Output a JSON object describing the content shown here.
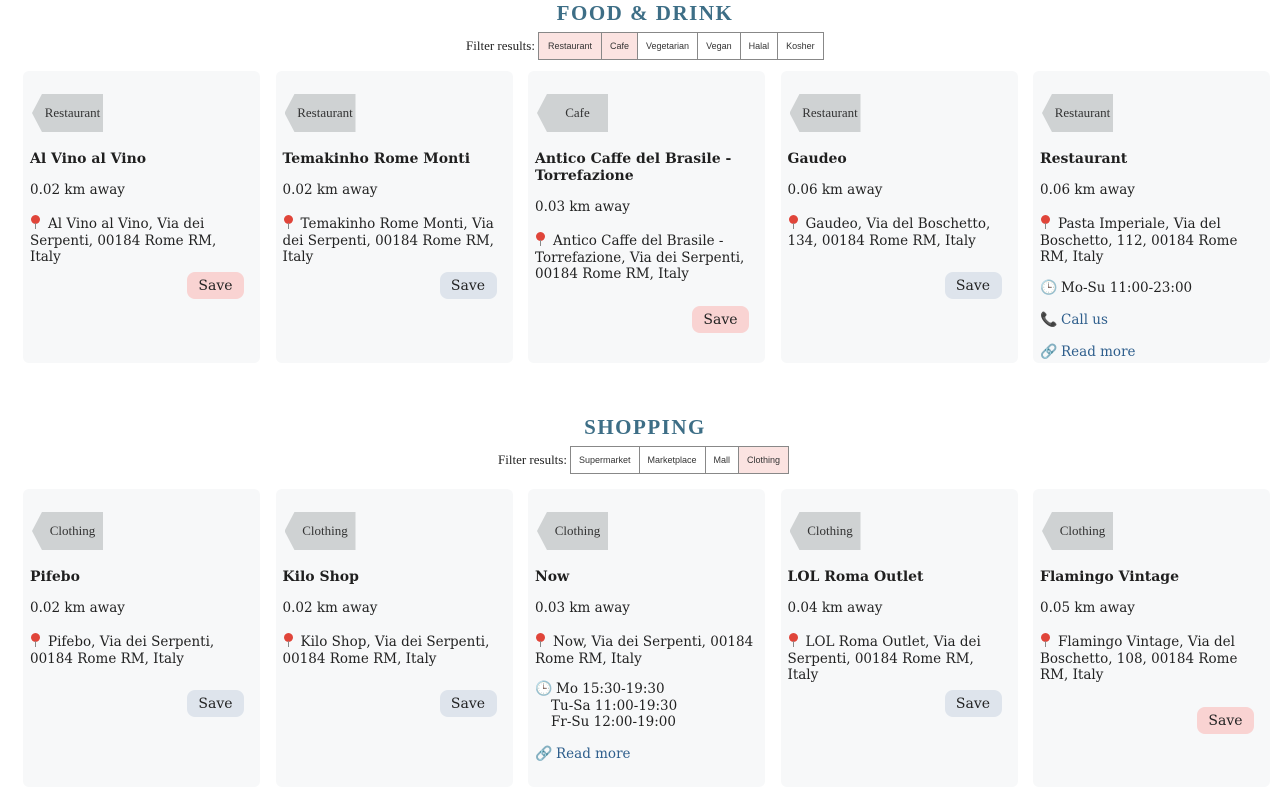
{
  "food": {
    "title": "FOOD & DRINK",
    "filter_label": "Filter results:",
    "filters": [
      "Restaurant",
      "Cafe",
      "Vegetarian",
      "Vegan",
      "Halal",
      "Kosher"
    ],
    "cards": [
      {
        "tag": "Restaurant",
        "name": "Al Vino al Vino",
        "distance": "0.02 km away",
        "address": "Al Vino al Vino, Via dei Serpenti, 00184 Rome RM, Italy",
        "save": "Save"
      },
      {
        "tag": "Restaurant",
        "name": "Temakinho Rome Monti",
        "distance": "0.02 km away",
        "address": "Temakinho Rome Monti, Via dei Serpenti, 00184 Rome RM, Italy",
        "save": "Save"
      },
      {
        "tag": "Cafe",
        "name": "Antico Caffe del Brasile - Torrefazione",
        "distance": "0.03 km away",
        "address": "Antico Caffe del Brasile - Torrefazione, Via dei Serpenti, 00184 Rome RM, Italy",
        "save": "Save"
      },
      {
        "tag": "Restaurant",
        "name": "Gaudeo",
        "distance": "0.06 km away",
        "address": "Gaudeo, Via del Boschetto, 134, 00184 Rome RM, Italy",
        "save": "Save"
      },
      {
        "tag": "Restaurant",
        "name": "Restaurant",
        "distance": "0.06 km away",
        "address": "Pasta Imperiale, Via del Boschetto, 112, 00184 Rome RM, Italy",
        "hours": "Mo-Su 11:00-23:00",
        "call": "Call us",
        "read_more": "Read more"
      }
    ]
  },
  "shopping": {
    "title": "SHOPPING",
    "filter_label": "Filter results:",
    "filters": [
      "Supermarket",
      "Marketplace",
      "Mall",
      "Clothing"
    ],
    "cards": [
      {
        "tag": "Clothing",
        "name": "Pifebo",
        "distance": "0.02 km away",
        "address": "Pifebo, Via dei Serpenti, 00184 Rome RM, Italy",
        "save": "Save"
      },
      {
        "tag": "Clothing",
        "name": "Kilo Shop",
        "distance": "0.02 km away",
        "address": "Kilo Shop, Via dei Serpenti, 00184 Rome RM, Italy",
        "save": "Save"
      },
      {
        "tag": "Clothing",
        "name": "Now",
        "distance": "0.03 km away",
        "address": "Now, Via dei Serpenti, 00184 Rome RM, Italy",
        "hours": [
          "Mo 15:30-19:30",
          "Tu-Sa 11:00-19:30",
          "Fr-Su 12:00-19:00"
        ],
        "read_more": "Read more"
      },
      {
        "tag": "Clothing",
        "name": "LOL Roma Outlet",
        "distance": "0.04 km away",
        "address": "LOL Roma Outlet, Via dei Serpenti, 00184 Rome RM, Italy",
        "save": "Save"
      },
      {
        "tag": "Clothing",
        "name": "Flamingo Vintage",
        "distance": "0.05 km away",
        "address": "Flamingo Vintage, Via del Boschetto, 108, 00184 Rome RM, Italy",
        "save": "Save"
      }
    ]
  },
  "icons": {
    "pin": "map-pin-icon",
    "clock": "clock-icon",
    "phone": "phone-icon",
    "link": "link-icon"
  },
  "colors": {
    "section_title": "#3d6e86",
    "card_bg": "#f7f8f9",
    "tag_bg": "#cfd2d3",
    "save_pink": "#f9d3d2",
    "save_blue": "#dee4ec",
    "active_chip": "#fbe3e1",
    "pin": "#e0453a"
  }
}
